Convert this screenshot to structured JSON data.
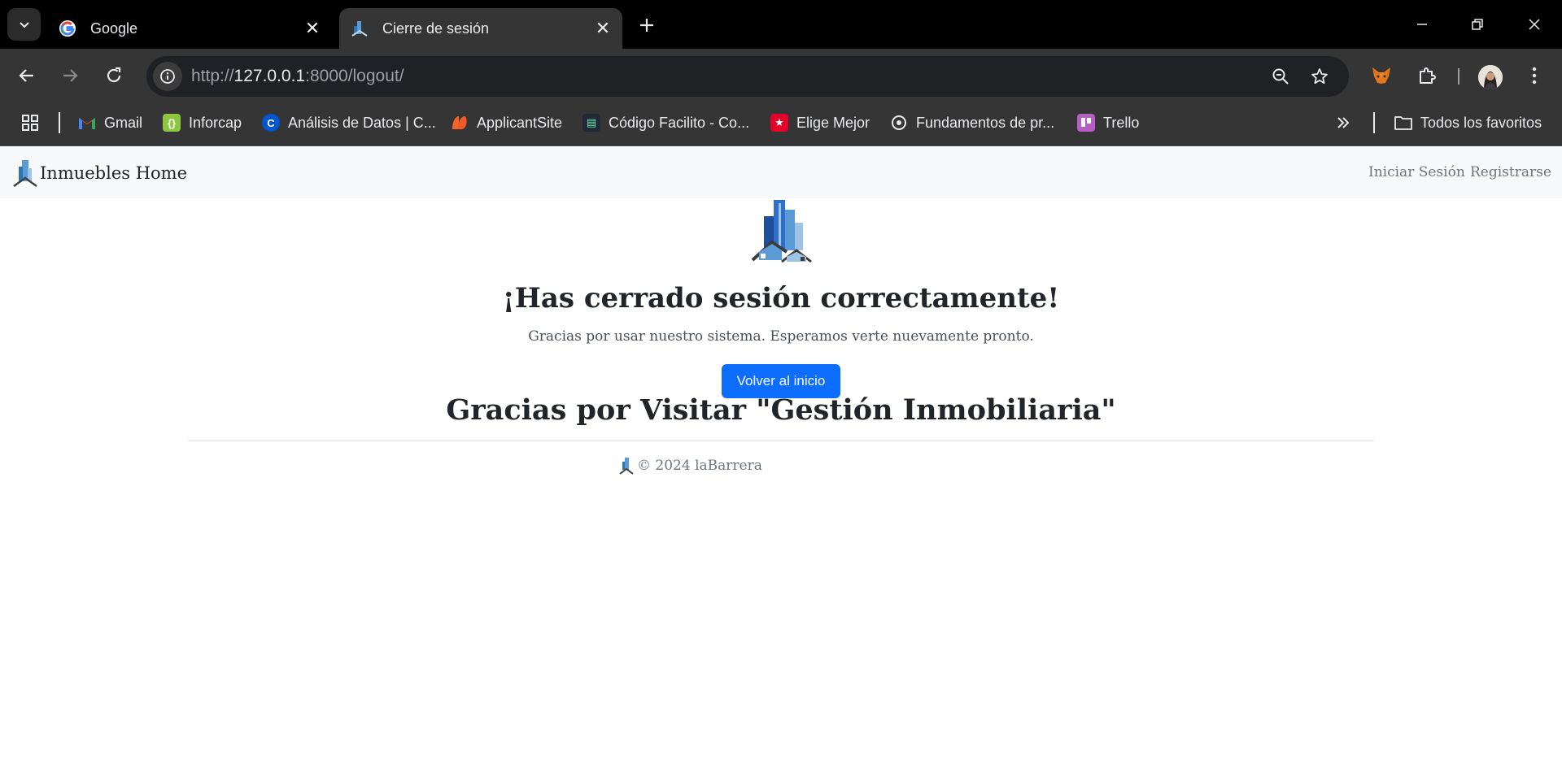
{
  "browser": {
    "tabs": [
      {
        "title": "Google",
        "favicon": "google-icon",
        "active": false
      },
      {
        "title": "Cierre de sesión",
        "favicon": "building-icon",
        "active": true
      }
    ],
    "url": {
      "scheme": "http://",
      "host": "127.0.0.1",
      "rest": ":8000/logout/"
    },
    "bookmarks": [
      {
        "label": "Gmail",
        "icon": "gmail-icon"
      },
      {
        "label": "Inforcap",
        "icon": "inforcap-icon"
      },
      {
        "label": "Análisis de Datos | C...",
        "icon": "coursera-icon"
      },
      {
        "label": "ApplicantSite",
        "icon": "applicantsite-icon"
      },
      {
        "label": "Código Facilito - Co...",
        "icon": "codigofacilito-icon"
      },
      {
        "label": "Elige Mejor",
        "icon": "eligemejor-icon"
      },
      {
        "label": "Fundamentos de pr...",
        "icon": "fundamentos-icon"
      },
      {
        "label": "Trello",
        "icon": "trello-icon"
      }
    ],
    "all_bookmarks_label": "Todos los favoritos",
    "colors": {
      "frame": "#000000",
      "toolbar": "#353535",
      "omnibox": "#202124"
    }
  },
  "site": {
    "brand": "Inmuebles Home",
    "nav": {
      "login": "Iniciar Sesión",
      "register": "Registrarse"
    },
    "heading": "¡Has cerrado sesión correctamente!",
    "subtext": "Gracias por usar nuestro sistema. Esperamos verte nuevamente pronto.",
    "button": "Volver al inicio",
    "footer_title": "Gracias por Visitar \"Gestión Inmobiliaria\"",
    "copyright": "© 2024 laBarrera",
    "colors": {
      "primary": "#0d6efd",
      "navbar": "#f8f9fa",
      "muted": "#6c757d"
    }
  }
}
